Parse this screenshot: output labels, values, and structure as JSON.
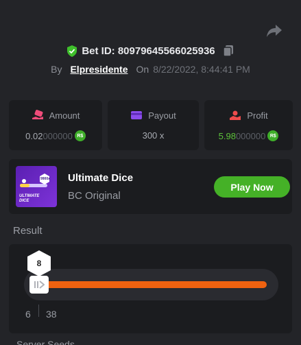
{
  "header": {
    "bet_id_label": "Bet ID: 80979645566025936",
    "by_label": "By",
    "username": "Elpresidente",
    "on_label": "On",
    "datetime": "8/22/2022, 8:44:41 PM"
  },
  "stats": {
    "amount": {
      "label": "Amount",
      "value_main": "0.02",
      "value_dim": "000000",
      "currency": "R$"
    },
    "payout": {
      "label": "Payout",
      "value": "300 x"
    },
    "profit": {
      "label": "Profit",
      "value_main": "5.98",
      "value_dim": "000000",
      "currency": "R$"
    }
  },
  "game": {
    "title": "Ultimate Dice",
    "subtitle": "BC Original",
    "thumb_text": "ULTIMATE DICE",
    "thumb_badge": "9900x",
    "play_label": "Play Now"
  },
  "result": {
    "label": "Result",
    "dice_value": "8",
    "range_min": "6",
    "range_max": "38"
  },
  "seeds": {
    "label": "Server Seeds"
  },
  "colors": {
    "accent_green": "#45b127",
    "bar_orange": "#ef6210",
    "background": "#232428",
    "card": "#1b1c1f"
  }
}
